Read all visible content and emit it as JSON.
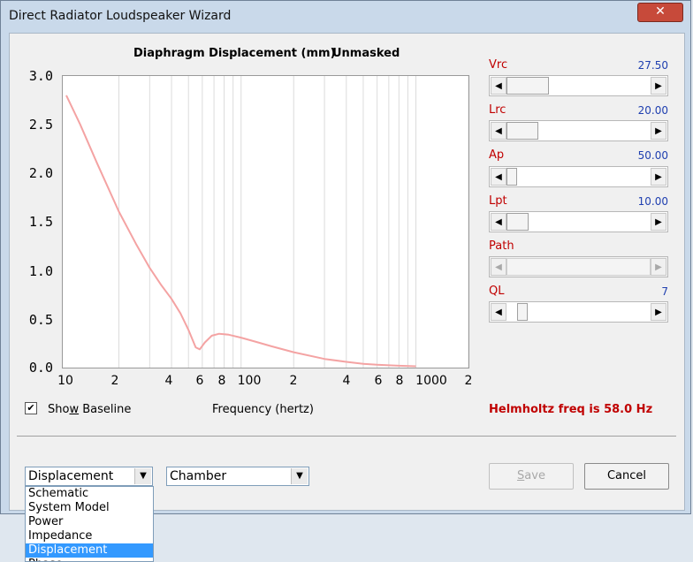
{
  "window": {
    "title": "Direct Radiator Loudspeaker Wizard",
    "close_glyph": "✕"
  },
  "chart": {
    "title": "Diaphragm Displacement (mm)",
    "mask_status": "Unmasked",
    "xlabel": "Frequency (hertz)",
    "line_color": "#f4a3a3",
    "y_tick_labels": [
      "3.0",
      "2.5",
      "2.0",
      "1.5",
      "1.0",
      "0.5",
      "0.0"
    ],
    "x_tick_labels": [
      "10",
      "2",
      "4",
      "6",
      "8",
      "100",
      "2",
      "4",
      "6",
      "8",
      "1000",
      "2"
    ]
  },
  "chart_data": {
    "type": "line",
    "title": "Diaphragm Displacement (mm)",
    "xlabel": "Frequency (hertz)",
    "ylabel": "",
    "x_scale": "log",
    "xlim": [
      10,
      2000
    ],
    "ylim": [
      0,
      3.0
    ],
    "grid": true,
    "series": [
      {
        "x": [
          10,
          12,
          15,
          20,
          25,
          30,
          35,
          40,
          45,
          50,
          55,
          58,
          62,
          68,
          75,
          85,
          100,
          120,
          150,
          200,
          300,
          400,
          500,
          600,
          700,
          800,
          1000
        ],
        "y": [
          2.8,
          2.5,
          2.1,
          1.6,
          1.27,
          1.02,
          0.84,
          0.7,
          0.55,
          0.38,
          0.2,
          0.18,
          0.25,
          0.32,
          0.34,
          0.33,
          0.3,
          0.26,
          0.21,
          0.15,
          0.08,
          0.05,
          0.03,
          0.02,
          0.015,
          0.01,
          0.005
        ]
      }
    ]
  },
  "checkbox": {
    "label_pre": "Sho",
    "label_mnemonic": "w",
    "label_post": " Baseline",
    "checked_glyph": "✔"
  },
  "helmholtz": {
    "text": "Helmholtz freq is 58.0 Hz"
  },
  "sliders": [
    {
      "label": "Vrc",
      "value": "27.50"
    },
    {
      "label": "Lrc",
      "value": "20.00"
    },
    {
      "label": "Ap",
      "value": "50.00"
    },
    {
      "label": "Lpt",
      "value": "10.00"
    },
    {
      "label": "Path",
      "value": ""
    },
    {
      "label": "QL",
      "value": "7"
    }
  ],
  "arrows": {
    "left": "◀",
    "right": "▶",
    "down": "▼"
  },
  "view_combo": {
    "value": "Displacement"
  },
  "enclosure_combo": {
    "value": "Chamber"
  },
  "buttons": {
    "save_mnemonic": "S",
    "save_rest": "ave",
    "cancel": "Cancel"
  },
  "view_options": [
    "Schematic",
    "System Model",
    "Power",
    "Impedance",
    "Displacement",
    "Phase"
  ],
  "selected_view": "Displacement"
}
